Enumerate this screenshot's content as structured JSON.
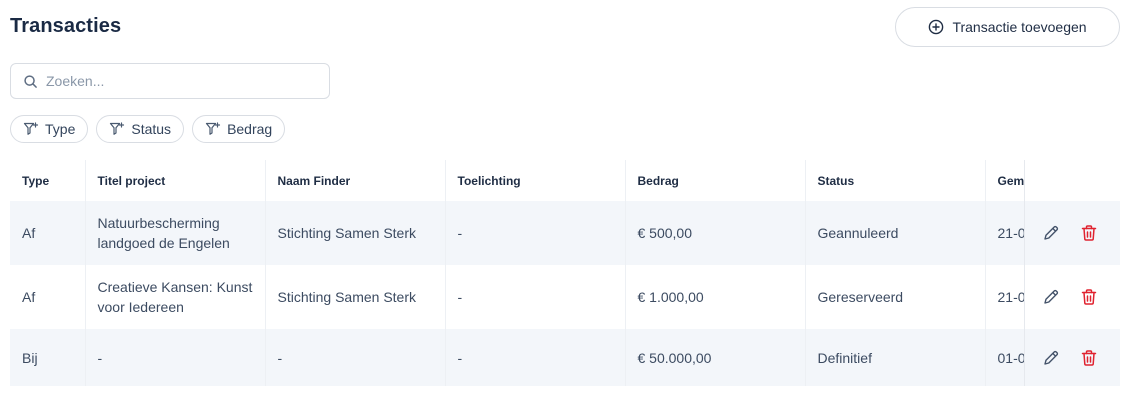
{
  "page": {
    "title": "Transacties"
  },
  "toolbar": {
    "add_label": "Transactie toevoegen"
  },
  "search": {
    "placeholder": "Zoeken...",
    "value": ""
  },
  "filters": [
    {
      "label": "Type"
    },
    {
      "label": "Status"
    },
    {
      "label": "Bedrag"
    }
  ],
  "table": {
    "columns": [
      "Type",
      "Titel project",
      "Naam Finder",
      "Toelichting",
      "Bedrag",
      "Status",
      "Gem"
    ],
    "rows": [
      [
        "Af",
        "Natuurbescherming landgoed de Engelen",
        "Stichting Samen Sterk",
        "-",
        "€ 500,00",
        "Geannuleerd",
        "21-0"
      ],
      [
        "Af",
        "Creatieve Kansen: Kunst voor Iedereen",
        "Stichting Samen Sterk",
        "-",
        "€ 1.000,00",
        "Gereserveerd",
        "21-0"
      ],
      [
        "Bij",
        "-",
        "-",
        "-",
        "€ 50.000,00",
        "Definitief",
        "01-0"
      ]
    ]
  },
  "icons": {
    "add": "plus-circle-icon",
    "search": "search-icon",
    "filter": "filter-plus-icon",
    "edit": "pencil-icon",
    "delete": "trash-icon"
  },
  "colors": {
    "text_primary": "#1a2a44",
    "row_alt_bg": "#f3f6fa",
    "border": "#d9dde3",
    "delete": "#e0222f"
  }
}
